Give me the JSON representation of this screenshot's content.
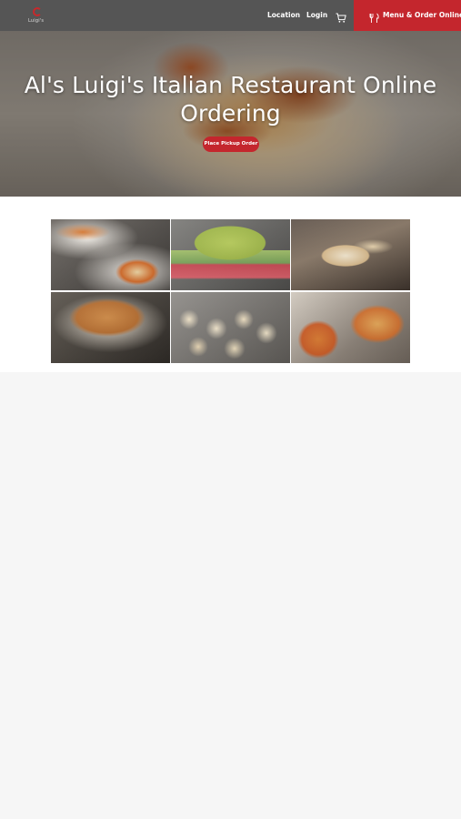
{
  "header": {
    "logo_text": "Luigi's",
    "nav": {
      "location": "Location",
      "login": "Login"
    },
    "menu_button": "Menu & Order Online",
    "icons": {
      "cart": "cart-icon",
      "utensils": "fork-knife-icon"
    }
  },
  "hero": {
    "title": "Al's Luigi's Italian Restaurant Online Ordering",
    "button": "Place Pickup Order"
  },
  "gallery": {
    "tiles": [
      "lasagna",
      "spumoni cake",
      "cannoli",
      "chicken in vodka sauce",
      "garlic rolls",
      "pizza"
    ]
  },
  "colors": {
    "brand_red": "#c4262d",
    "header_gray": "#555555",
    "page_bg": "#f6f6f6"
  }
}
